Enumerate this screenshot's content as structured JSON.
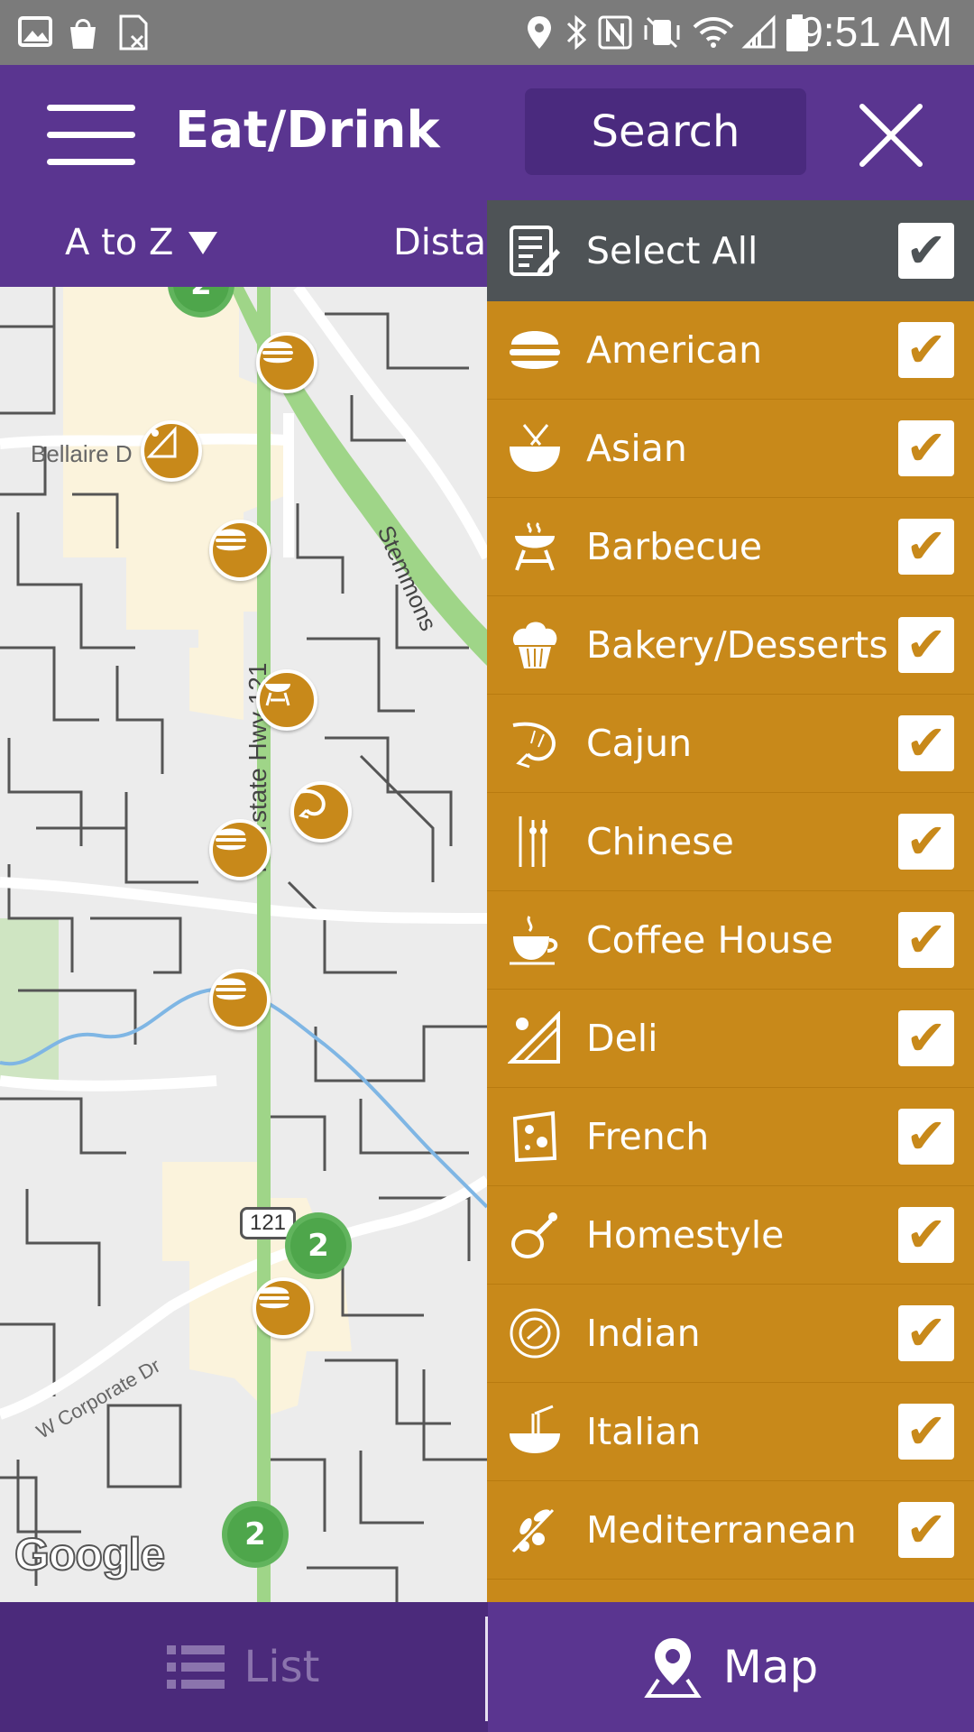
{
  "status_bar": {
    "time": "9:51 AM"
  },
  "app_bar": {
    "title": "Eat/Drink",
    "search_label": "Search"
  },
  "sort_bar": {
    "sort_label": "A to Z",
    "distance_label": "Distar"
  },
  "map": {
    "street_labels": [
      "Bellaire D",
      "Stemmons",
      "W Corporate Dr",
      "Interstate Hwy 121"
    ],
    "highway_shield": "121",
    "clusters": [
      "2",
      "2",
      "2"
    ],
    "attribution": "Google"
  },
  "filter_panel": {
    "select_all": {
      "label": "Select All",
      "icon": "list-edit-icon",
      "checked": true
    },
    "categories": [
      {
        "label": "American",
        "icon": "burger-icon",
        "checked": true
      },
      {
        "label": "Asian",
        "icon": "bowl-chopsticks-icon",
        "checked": true
      },
      {
        "label": "Barbecue",
        "icon": "grill-icon",
        "checked": true
      },
      {
        "label": "Bakery/Desserts",
        "icon": "cupcake-icon",
        "checked": true
      },
      {
        "label": "Cajun",
        "icon": "shrimp-icon",
        "checked": true
      },
      {
        "label": "Chinese",
        "icon": "chopsticks-icon",
        "checked": true
      },
      {
        "label": "Coffee House",
        "icon": "coffee-cup-icon",
        "checked": true
      },
      {
        "label": "Deli",
        "icon": "sandwich-icon",
        "checked": true
      },
      {
        "label": "French",
        "icon": "cheese-icon",
        "checked": true
      },
      {
        "label": "Homestyle",
        "icon": "drumstick-icon",
        "checked": true
      },
      {
        "label": "Indian",
        "icon": "plate-icon",
        "checked": true
      },
      {
        "label": "Italian",
        "icon": "noodles-icon",
        "checked": true
      },
      {
        "label": "Mediterranean",
        "icon": "olive-branch-icon",
        "checked": true
      }
    ],
    "checkmark": "✔"
  },
  "bottom_nav": {
    "list_label": "List",
    "map_label": "Map"
  },
  "colors": {
    "purple": "#5a3590",
    "gold": "#c8891a",
    "dark_gray": "#4e5356",
    "green": "#4ea64b"
  }
}
